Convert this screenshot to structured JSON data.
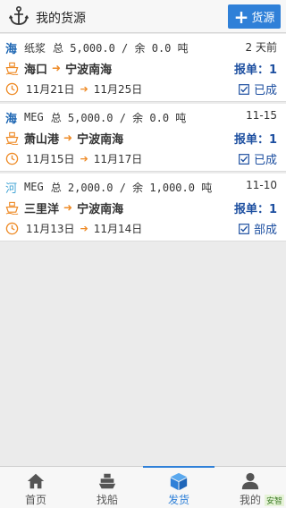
{
  "header": {
    "title": "我的货源",
    "add_label": "货源"
  },
  "cargo": [
    {
      "type": "海",
      "goods": "纸浆",
      "summary": "总 5,000.0 / 余 0.0 吨",
      "time": "2 天前",
      "from": "海口",
      "to": "宁波南海",
      "bids": "报单：1",
      "date_from": "11月21日",
      "date_to": "11月25日",
      "status": "已成"
    },
    {
      "type": "海",
      "goods": "MEG",
      "summary": "总 5,000.0 / 余 0.0 吨",
      "time": "11-15",
      "from": "萧山港",
      "to": "宁波南海",
      "bids": "报单：1",
      "date_from": "11月15日",
      "date_to": "11月17日",
      "status": "已成"
    },
    {
      "type": "河",
      "goods": "MEG",
      "summary": "总 2,000.0 / 余 1,000.0 吨",
      "time": "11-10",
      "from": "三里洋",
      "to": "宁波南海",
      "bids": "报单：1",
      "date_from": "11月13日",
      "date_to": "11月14日",
      "status": "部成"
    }
  ],
  "tabs": [
    "首页",
    "找船",
    "发货",
    "我的"
  ],
  "brand": "安智",
  "colors": {
    "accent": "#2f80d8",
    "arrow": "#ee8a25",
    "dark_blue": "#1d4fa0"
  }
}
